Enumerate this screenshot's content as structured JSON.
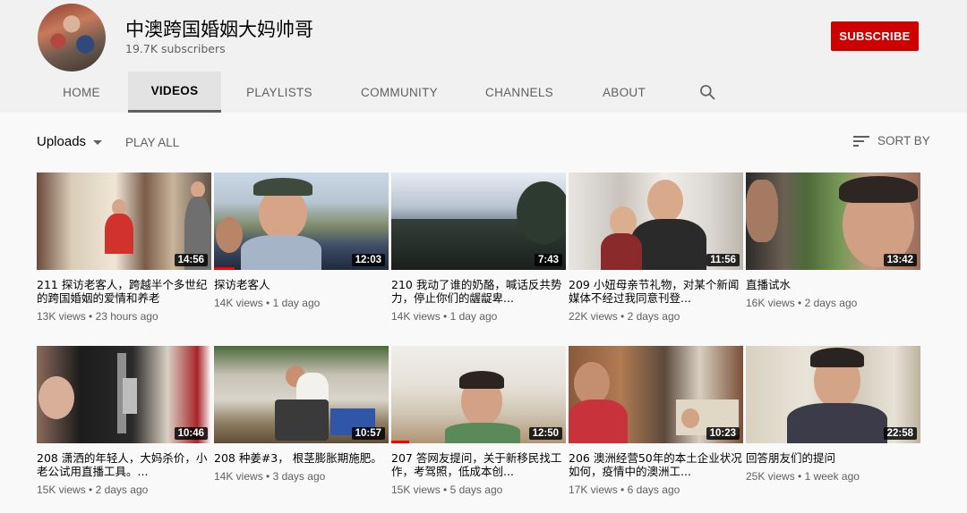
{
  "channel": {
    "name": "中澳跨国婚姻大妈帅哥",
    "subscribers": "19.7K subscribers",
    "subscribe_label": "SUBSCRIBE",
    "subscribe_color": "#cc0000"
  },
  "tabs": [
    {
      "label": "HOME",
      "active": false
    },
    {
      "label": "VIDEOS",
      "active": true
    },
    {
      "label": "PLAYLISTS",
      "active": false
    },
    {
      "label": "COMMUNITY",
      "active": false
    },
    {
      "label": "CHANNELS",
      "active": false
    },
    {
      "label": "ABOUT",
      "active": false
    }
  ],
  "search_icon": "search-icon",
  "controls": {
    "uploads_label": "Uploads",
    "play_all_label": "PLAY ALL",
    "sort_by_label": "SORT BY"
  },
  "videos": [
    {
      "title": "211 探访老客人，跨越半个多世纪的跨国婚姻的爱情和养老",
      "views": "13K views",
      "age": "23 hours ago",
      "duration": "14:56",
      "watched_fraction": 0
    },
    {
      "title": "探访老客人",
      "views": "14K views",
      "age": "1 day ago",
      "duration": "12:03",
      "watched_fraction": 0.12
    },
    {
      "title": "210 我动了谁的奶酪，喊话反共势力，停止你们的龌龊卑...",
      "views": "14K views",
      "age": "1 day ago",
      "duration": "7:43",
      "watched_fraction": 0
    },
    {
      "title": "209 小妞母亲节礼物，对某个新闻媒体不经过我同意刊登...",
      "views": "22K views",
      "age": "2 days ago",
      "duration": "11:56",
      "watched_fraction": 0
    },
    {
      "title": "直播试水",
      "views": "16K views",
      "age": "2 days ago",
      "duration": "13:42",
      "watched_fraction": 0
    },
    {
      "title": "208 潇洒的年轻人，大妈杀价，小老公试用直播工具。...",
      "views": "15K views",
      "age": "2 days ago",
      "duration": "10:46",
      "watched_fraction": 0
    },
    {
      "title": "208 种姜#3， 根茎膨胀期施肥。",
      "views": "14K views",
      "age": "3 days ago",
      "duration": "10:57",
      "watched_fraction": 0
    },
    {
      "title": "207 答网友提问，关于新移民找工作，考驾照，低成本创...",
      "views": "15K views",
      "age": "5 days ago",
      "duration": "12:50",
      "watched_fraction": 0.1
    },
    {
      "title": "206 澳洲经营50年的本土企业状况如何，疫情中的澳洲工...",
      "views": "17K views",
      "age": "6 days ago",
      "duration": "10:23",
      "watched_fraction": 0
    },
    {
      "title": "回答朋友们的提问",
      "views": "25K views",
      "age": "1 week ago",
      "duration": "22:58",
      "watched_fraction": 0
    }
  ]
}
